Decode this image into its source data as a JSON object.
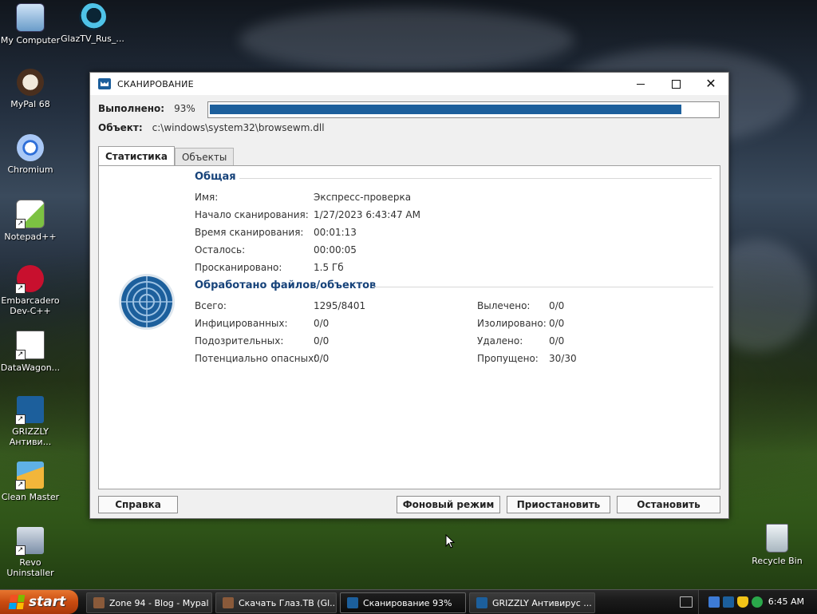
{
  "desktop": {
    "icons": [
      {
        "label": "My Computer"
      },
      {
        "label": "GlazTV_Rus_..."
      },
      {
        "label": "MyPal 68"
      },
      {
        "label": "Chromium"
      },
      {
        "label": "Notepad++"
      },
      {
        "label": "Embarcadero Dev-C++"
      },
      {
        "label": "DataWagon..."
      },
      {
        "label": "GRIZZLY Антиви..."
      },
      {
        "label": "Clean Master"
      },
      {
        "label": "Revo Uninstaller"
      },
      {
        "label": "Recycle Bin"
      }
    ]
  },
  "window": {
    "title": "СКАНИРОВАНИЕ",
    "progress": {
      "label": "Выполнено:",
      "percent_text": "93%",
      "value": 0.93
    },
    "object": {
      "label": "Объект:",
      "value": "c:\\windows\\system32\\browsewm.dll"
    },
    "tabs": [
      {
        "label": "Статистика",
        "active": true
      },
      {
        "label": "Объекты",
        "active": false
      }
    ],
    "general": {
      "heading": "Общая",
      "rows": [
        {
          "key": "Имя:",
          "value": "Экспресс-проверка"
        },
        {
          "key": "Начало сканирования:",
          "value": "1/27/2023 6:43:47 AM"
        },
        {
          "key": "Время сканирования:",
          "value": "00:01:13"
        },
        {
          "key": "Осталось:",
          "value": "00:00:05"
        },
        {
          "key": "Просканировано:",
          "value": "1.5 Гб"
        }
      ]
    },
    "processed": {
      "heading": "Обработано файлов/объектов",
      "left": [
        {
          "key": "Всего:",
          "value": "1295/8401"
        },
        {
          "key": "Инфицированных:",
          "value": "0/0"
        },
        {
          "key": "Подозрительных:",
          "value": "0/0"
        },
        {
          "key": "Потенциально опасных:",
          "value": "0/0"
        }
      ],
      "right": [
        {
          "key": "Вылечено:",
          "value": "0/0"
        },
        {
          "key": "Изолировано:",
          "value": "0/0"
        },
        {
          "key": "Удалено:",
          "value": "0/0"
        },
        {
          "key": "Пропущено:",
          "value": "30/30"
        }
      ]
    },
    "buttons": {
      "help": "Справка",
      "background": "Фоновый режим",
      "pause": "Приостановить",
      "stop": "Остановить"
    }
  },
  "taskbar": {
    "start_label": "start",
    "tasks": [
      {
        "label": "Zone 94 - Blog - Mypal",
        "active": false
      },
      {
        "label": "Скачать Глаз.ТВ (Gl...",
        "active": false
      },
      {
        "label": "Сканирование 93%",
        "active": true
      },
      {
        "label": "GRIZZLY Антивирус ...",
        "active": false
      }
    ],
    "clock": "6:45 AM"
  },
  "colors": {
    "accent": "#1c5f9c",
    "heading": "#17437a",
    "start": "#c94b10"
  }
}
